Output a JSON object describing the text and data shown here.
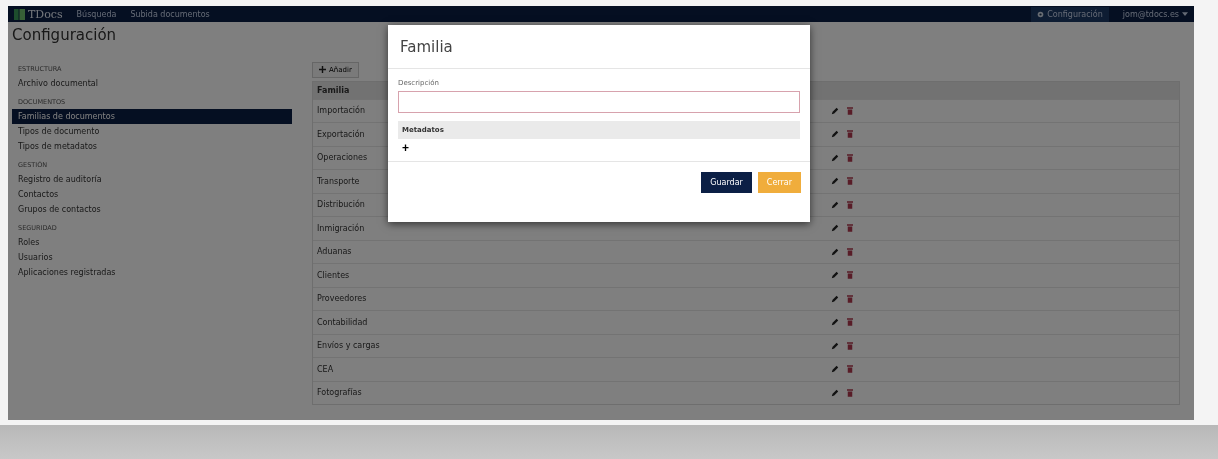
{
  "navbar": {
    "brand": "TDocs",
    "links": [
      "Búsqueda",
      "Subida documentos"
    ],
    "settings": "Configuración",
    "user": "jom@tdocs.es"
  },
  "page_title": "Configuración",
  "sidebar": {
    "sections": [
      {
        "heading": "ESTRUCTURA",
        "items": [
          {
            "label": "Archivo documental",
            "selected": false
          }
        ]
      },
      {
        "heading": "DOCUMENTOS",
        "items": [
          {
            "label": "Familias de documentos",
            "selected": true
          },
          {
            "label": "Tipos de documento",
            "selected": false
          },
          {
            "label": "Tipos de metadatos",
            "selected": false
          }
        ]
      },
      {
        "heading": "GESTIÓN",
        "items": [
          {
            "label": "Registro de auditoría",
            "selected": false
          },
          {
            "label": "Contactos",
            "selected": false
          },
          {
            "label": "Grupos de contactos",
            "selected": false
          }
        ]
      },
      {
        "heading": "SEGURIDAD",
        "items": [
          {
            "label": "Roles",
            "selected": false
          },
          {
            "label": "Usuarios",
            "selected": false
          },
          {
            "label": "Aplicaciones registradas",
            "selected": false
          }
        ]
      }
    ]
  },
  "table": {
    "add_button": "Añadir",
    "columns": [
      "Familia"
    ],
    "rows": [
      "Importación",
      "Exportación",
      "Operaciones",
      "Transporte",
      "Distribución",
      "Inmigración",
      "Aduanas",
      "Clientes",
      "Proveedores",
      "Contabilidad",
      "Envíos y cargas",
      "CEA",
      "Fotografías"
    ]
  },
  "modal": {
    "title": "Familia",
    "field_label": "Descripción",
    "metadata_header": "Metadatos",
    "add_symbol": "+",
    "buttons": [
      {
        "label": "Guardar",
        "kind": "primary"
      },
      {
        "label": "Cerrar",
        "kind": "warning"
      }
    ]
  }
}
